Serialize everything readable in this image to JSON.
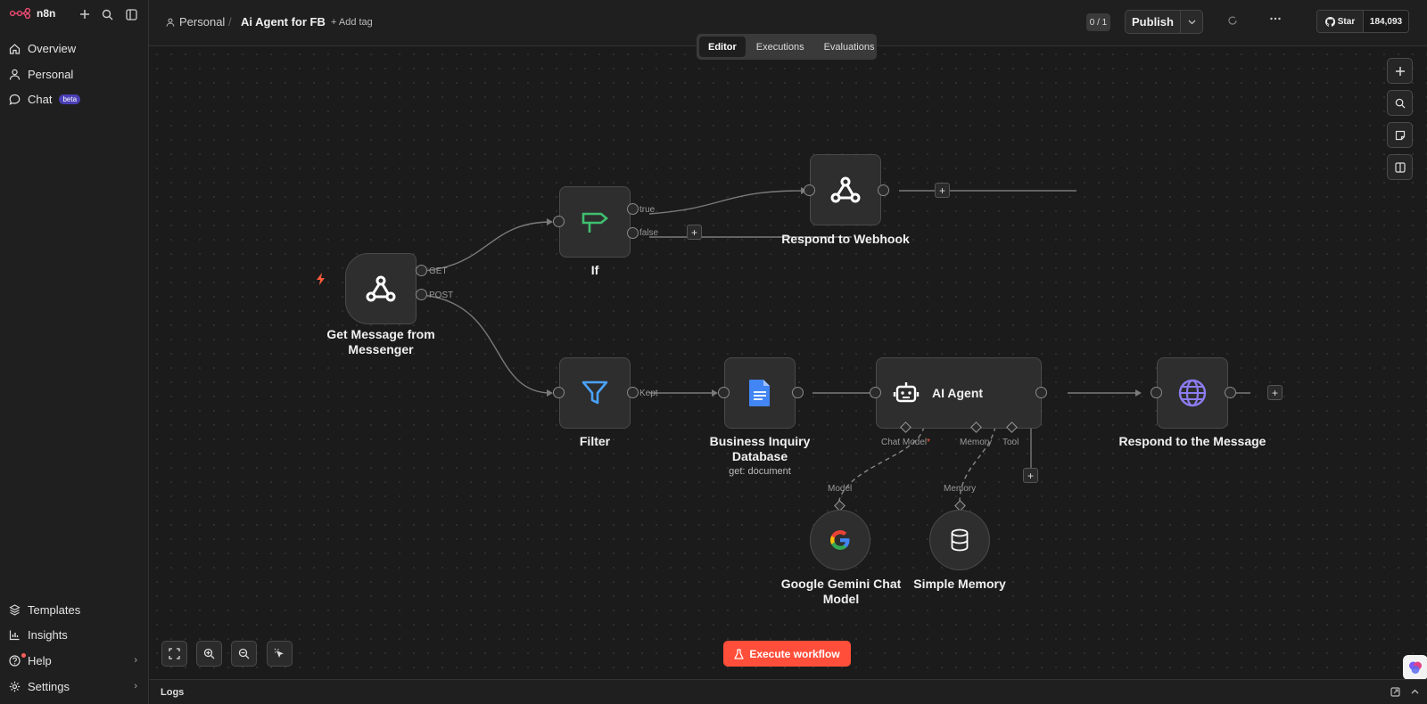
{
  "app": {
    "logo_text": "n8n"
  },
  "sidebar": {
    "nav": [
      {
        "label": "Overview",
        "icon": "home-icon"
      },
      {
        "label": "Personal",
        "icon": "user-icon"
      },
      {
        "label": "Chat",
        "icon": "chat-icon",
        "badge": "beta"
      }
    ],
    "bottom": [
      {
        "label": "Templates",
        "icon": "templates-icon"
      },
      {
        "label": "Insights",
        "icon": "chart-icon"
      },
      {
        "label": "Help",
        "icon": "help-icon"
      },
      {
        "label": "Settings",
        "icon": "gear-icon"
      }
    ]
  },
  "header": {
    "breadcrumb": "Personal",
    "separator": "/",
    "workflow_title": "Ai Agent for FB",
    "add_tag": "+ Add tag",
    "counter": "0 / 1",
    "publish_label": "Publish",
    "github_star": "Star",
    "github_count": "184,093"
  },
  "tabs": [
    {
      "label": "Editor",
      "active": true
    },
    {
      "label": "Executions",
      "active": false
    },
    {
      "label": "Evaluations",
      "active": false
    }
  ],
  "nodes": {
    "get_message": {
      "label": "Get Message from Messenger",
      "ports": [
        "GET",
        "POST"
      ]
    },
    "if": {
      "label": "If",
      "ports": [
        "true",
        "false"
      ]
    },
    "respond_webhook": {
      "label": "Respond to Webhook"
    },
    "filter": {
      "label": "Filter",
      "ports": [
        "Kept"
      ]
    },
    "business_db": {
      "label": "Business Inquiry Database",
      "subtitle": "get: document"
    },
    "ai_agent": {
      "label": "AI Agent",
      "ports": [
        "Chat Model",
        "Memory",
        "Tool"
      ],
      "required_mark": "*"
    },
    "respond_message": {
      "label": "Respond to the Message"
    },
    "gemini": {
      "label": "Google Gemini Chat Model",
      "port": "Model"
    },
    "memory": {
      "label": "Simple Memory",
      "port": "Memory"
    }
  },
  "canvas": {
    "execute_label": "Execute workflow",
    "add_symbol": "+"
  },
  "logs": {
    "label": "Logs"
  },
  "colors": {
    "accent": "#ff4e3a",
    "if_icon": "#3fbf6f",
    "filter_icon": "#4aa3ff",
    "docs_icon": "#4285f4",
    "globe_icon": "#8c7cf0",
    "trigger_bolt": "#ff5a3a"
  }
}
